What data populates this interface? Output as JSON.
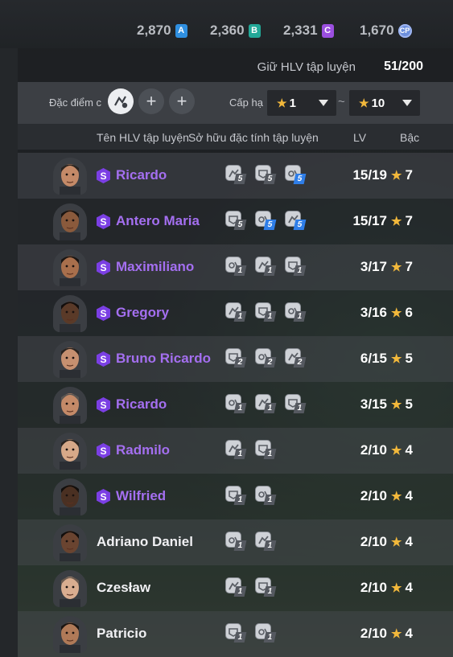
{
  "currencies": [
    {
      "value": "2,870",
      "badge": "A",
      "color": "#2f8fe0"
    },
    {
      "value": "2,360",
      "badge": "B",
      "color": "#22a898"
    },
    {
      "value": "2,331",
      "badge": "C",
      "color": "#9b4fe0"
    },
    {
      "value": "1,670",
      "badge": "CP",
      "icon": "cp-coin-icon",
      "color": "#6c8fdc"
    }
  ],
  "capacity": {
    "label": "Giữ HLV tập luyện",
    "value": "51/200"
  },
  "filter": {
    "trait_label": "Đặc điểm c",
    "trait_slots": [
      {
        "type": "filled",
        "icon": "trait-icon"
      },
      {
        "type": "add",
        "glyph": "+"
      },
      {
        "type": "add",
        "glyph": "+"
      }
    ],
    "rank_label": "Cấp hạ",
    "rank_min": "1",
    "rank_sep": "~",
    "rank_max": "10",
    "star": "★"
  },
  "columns": {
    "name": "Tên HLV tập luyện",
    "traits": "Sở hữu đặc tính tập luyện",
    "lv": "LV",
    "grade": "Bậc"
  },
  "coaches": [
    {
      "name": "Ricardo",
      "special": true,
      "traits": [
        {
          "level": "5",
          "highlight": false
        },
        {
          "level": "5",
          "highlight": false
        },
        {
          "level": "5",
          "highlight": true
        }
      ],
      "lv": "15/19",
      "grade": "7",
      "skin": "#c48a68",
      "hair": "#2a2420"
    },
    {
      "name": "Antero Maria",
      "special": true,
      "traits": [
        {
          "level": "5",
          "highlight": false
        },
        {
          "level": "5",
          "highlight": true
        },
        {
          "level": "5",
          "highlight": true
        }
      ],
      "lv": "15/17",
      "grade": "7",
      "skin": "#8a5a3c",
      "hair": "#1a1512"
    },
    {
      "name": "Maximiliano",
      "special": true,
      "traits": [
        {
          "level": "1",
          "highlight": false
        },
        {
          "level": "1",
          "highlight": false
        },
        {
          "level": "1",
          "highlight": false
        }
      ],
      "lv": "3/17",
      "grade": "7",
      "skin": "#a86f4c",
      "hair": "#1a1512"
    },
    {
      "name": "Gregory",
      "special": true,
      "traits": [
        {
          "level": "1",
          "highlight": false
        },
        {
          "level": "1",
          "highlight": false
        },
        {
          "level": "1",
          "highlight": false
        }
      ],
      "lv": "3/16",
      "grade": "6",
      "skin": "#5a3a28",
      "hair": "#120e0c"
    },
    {
      "name": "Bruno Ricardo",
      "special": true,
      "traits": [
        {
          "level": "2",
          "highlight": false
        },
        {
          "level": "2",
          "highlight": false
        },
        {
          "level": "2",
          "highlight": false
        }
      ],
      "lv": "6/15",
      "grade": "5",
      "skin": "#c69070",
      "hair": "#2a2420"
    },
    {
      "name": "Ricardo",
      "special": true,
      "traits": [
        {
          "level": "1",
          "highlight": false
        },
        {
          "level": "1",
          "highlight": false
        },
        {
          "level": "1",
          "highlight": false
        }
      ],
      "lv": "3/15",
      "grade": "5",
      "skin": "#c48a68",
      "hair": "#5a5552"
    },
    {
      "name": "Radmilo",
      "special": true,
      "traits": [
        {
          "level": "1",
          "highlight": false
        },
        {
          "level": "1",
          "highlight": false
        }
      ],
      "lv": "2/10",
      "grade": "4",
      "skin": "#d6a888",
      "hair": "#2a2420"
    },
    {
      "name": "Wilfried",
      "special": true,
      "traits": [
        {
          "level": "1",
          "highlight": false
        },
        {
          "level": "1",
          "highlight": false
        }
      ],
      "lv": "2/10",
      "grade": "4",
      "skin": "#4a3022",
      "hair": "#120e0c"
    },
    {
      "name": "Adriano Daniel",
      "special": false,
      "traits": [
        {
          "level": "1",
          "highlight": false
        },
        {
          "level": "1",
          "highlight": false
        }
      ],
      "lv": "2/10",
      "grade": "4",
      "skin": "#6a4430",
      "hair": "#120e0c"
    },
    {
      "name": "Czesław",
      "special": false,
      "traits": [
        {
          "level": "1",
          "highlight": false
        },
        {
          "level": "1",
          "highlight": false
        }
      ],
      "lv": "2/10",
      "grade": "4",
      "skin": "#d9ad90",
      "hair": "#6a5a50"
    },
    {
      "name": "Patricio",
      "special": false,
      "traits": [
        {
          "level": "1",
          "highlight": false
        },
        {
          "level": "1",
          "highlight": false
        }
      ],
      "lv": "2/10",
      "grade": "4",
      "skin": "#b07a58",
      "hair": "#1a1512"
    }
  ],
  "colors": {
    "special_name": "#a46ff0",
    "star": "#f2b83b",
    "badge_s": "#7b3fe4",
    "highlight_level": "#2f7ee8"
  }
}
